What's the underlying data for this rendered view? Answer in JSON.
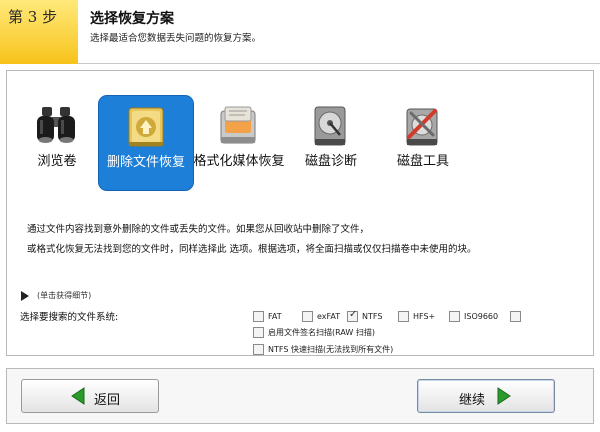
{
  "header": {
    "step": "第 3 步",
    "title": "选择恢复方案",
    "subtitle": "选择最适合您数据丢失问题的恢复方案。"
  },
  "options": [
    {
      "name": "option-browse-volume",
      "label": "浏览卷",
      "icon": "binoculars-icon",
      "selected": false
    },
    {
      "name": "option-deleted-file-recovery",
      "label": "删除文件恢复",
      "icon": "recycle-drive-icon",
      "selected": true
    },
    {
      "name": "option-format-media-recovery",
      "label": "格式化媒体恢复",
      "icon": "format-drive-icon",
      "selected": false
    },
    {
      "name": "option-disk-diagnostics",
      "label": "磁盘诊断",
      "icon": "hard-disk-icon",
      "selected": false
    },
    {
      "name": "option-disk-tools",
      "label": "磁盘工具",
      "icon": "disk-tools-icon",
      "selected": false
    }
  ],
  "description": {
    "line1": "通过文件内容找到意外删除的文件或丢失的文件。如果您从回收站中删除了文件，",
    "line2": "或格式化恢复无法找到您的文件时，同样选择此 选项。根据选项，将全面扫描或仅仅扫描卷中未使用的块。"
  },
  "details_toggle": "(单击获得细节)",
  "filesystem": {
    "label": "选择要搜索的文件系统:",
    "items": [
      {
        "label": "FAT",
        "checked": false
      },
      {
        "label": "exFAT",
        "checked": false
      },
      {
        "label": "NTFS",
        "checked": true
      },
      {
        "label": "HFS+",
        "checked": false
      },
      {
        "label": "ISO9660",
        "checked": false
      },
      {
        "label": "",
        "checked": false
      }
    ],
    "signature_scan": {
      "label": "启用文件签名扫描(RAW 扫描)",
      "checked": false
    },
    "ntfs_quick": {
      "label": "NTFS 快速扫描(无法找到所有文件)",
      "checked": false
    }
  },
  "footer": {
    "back_label": "返回",
    "next_label": "继续"
  },
  "colors": {
    "selected_bg": "#1d7fd8",
    "step_badge": "#f7c31b",
    "arrow_green": "#2a9a2a"
  }
}
